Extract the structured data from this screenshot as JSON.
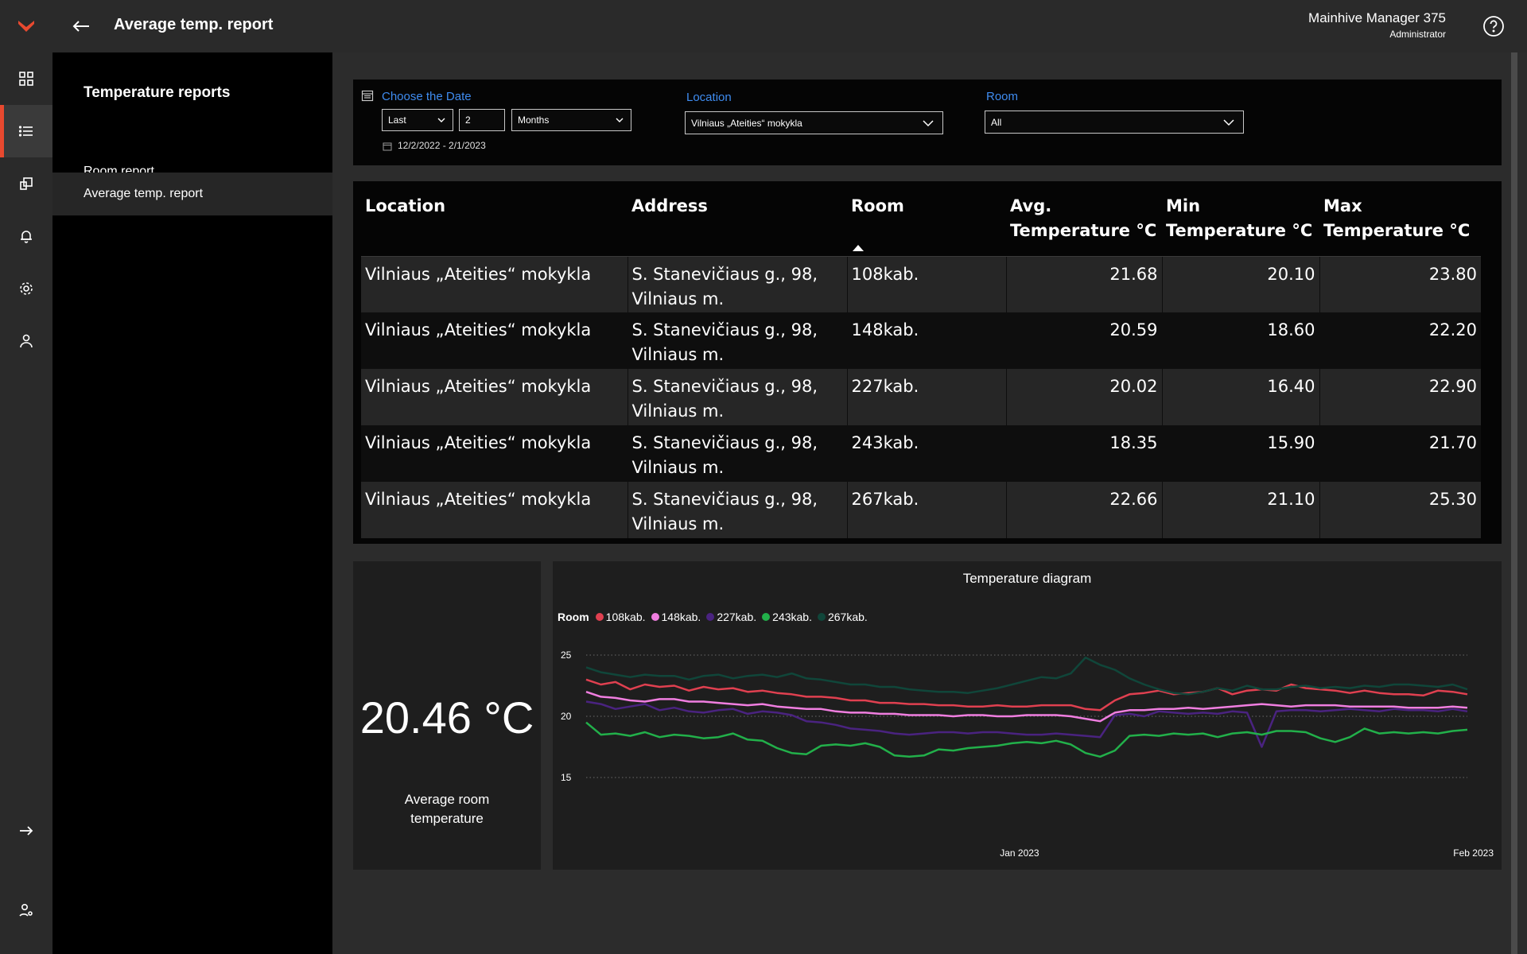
{
  "app": {
    "page_title": "Average temp. report",
    "user_name": "Mainhive Manager 375",
    "user_role": "Administrator",
    "accent": "#e8492f"
  },
  "rail": {
    "icons": [
      "logo-icon",
      "dashboard-icon",
      "reports-list-icon",
      "devices-icon",
      "bell-icon",
      "gear-icon",
      "user-icon",
      "expand-arrow-icon",
      "user-settings-icon"
    ],
    "active": "reports-list-icon"
  },
  "subnav": {
    "title": "Temperature reports",
    "items": [
      {
        "label": "Room report"
      },
      {
        "label": "Average temp. report"
      }
    ]
  },
  "filters": {
    "date_label": "Choose the Date",
    "period_mode": "Last",
    "period_count": "2",
    "period_unit": "Months",
    "date_range": "12/2/2022 - 2/1/2023",
    "location_label": "Location",
    "location_value": "Vilniaus „Ateities“ mokykla",
    "room_label": "Room",
    "room_value": "All"
  },
  "table": {
    "headers": [
      "Location",
      "Address",
      "Room",
      "Avg. Temperature °C",
      "Min Temperature °C",
      "Max Temperature °C"
    ],
    "rows": [
      {
        "location": "Vilniaus „Ateities“ mokykla",
        "address": "S. Stanevičiaus g., 98, Vilniaus m.",
        "room": "108kab.",
        "avg": "21.68",
        "min": "20.10",
        "max": "23.80"
      },
      {
        "location": "Vilniaus „Ateities“ mokykla",
        "address": "S. Stanevičiaus g., 98, Vilniaus m.",
        "room": "148kab.",
        "avg": "20.59",
        "min": "18.60",
        "max": "22.20"
      },
      {
        "location": "Vilniaus „Ateities“ mokykla",
        "address": "S. Stanevičiaus g., 98, Vilniaus m.",
        "room": "227kab.",
        "avg": "20.02",
        "min": "16.40",
        "max": "22.90"
      },
      {
        "location": "Vilniaus „Ateities“ mokykla",
        "address": "S. Stanevičiaus g., 98, Vilniaus m.",
        "room": "243kab.",
        "avg": "18.35",
        "min": "15.90",
        "max": "21.70"
      },
      {
        "location": "Vilniaus „Ateities“ mokykla",
        "address": "S. Stanevičiaus g., 98, Vilniaus m.",
        "room": "267kab.",
        "avg": "22.66",
        "min": "21.10",
        "max": "25.30"
      }
    ]
  },
  "kpi": {
    "value": "20.46 °C",
    "label": "Average room temperature"
  },
  "chart_data": {
    "type": "line",
    "title": "Temperature diagram",
    "legend_title": "Room",
    "legend_position": "top-left",
    "x_ticks": [
      "Jan 2023",
      "Feb 2023"
    ],
    "x_range": [
      "2022-12-02",
      "2023-02-01"
    ],
    "ylim": [
      15,
      25
    ],
    "y_ticks": [
      15,
      20,
      25
    ],
    "grid": "horizontal dotted",
    "series": [
      {
        "name": "108kab.",
        "color": "#e04050",
        "values": [
          23.0,
          22.6,
          22.8,
          22.2,
          22.6,
          22.4,
          22.5,
          22.1,
          22.4,
          22.2,
          22.3,
          22.0,
          22.1,
          21.9,
          21.8,
          21.6,
          21.6,
          21.5,
          21.3,
          21.3,
          21.1,
          21.1,
          21.0,
          21.0,
          20.9,
          20.9,
          20.8,
          20.8,
          20.9,
          20.8,
          20.8,
          20.9,
          20.9,
          20.9,
          20.6,
          20.5,
          21.3,
          21.8,
          21.9,
          22.1,
          21.8,
          21.9,
          22.0,
          22.3,
          21.8,
          22.1,
          22.2,
          22.1,
          22.6,
          22.3,
          22.2,
          22.1,
          21.9,
          22.1,
          21.9,
          21.8,
          21.8,
          21.7,
          22.1,
          22.0,
          21.8
        ]
      },
      {
        "name": "148kab.",
        "color": "#f07ee0",
        "values": [
          22.0,
          21.6,
          21.5,
          21.3,
          21.2,
          21.4,
          21.4,
          21.2,
          21.2,
          21.1,
          21.0,
          20.9,
          21.0,
          20.8,
          20.7,
          20.6,
          20.6,
          20.4,
          20.3,
          20.3,
          20.2,
          20.2,
          20.1,
          20.1,
          20.1,
          20.0,
          20.1,
          20.1,
          20.0,
          20.0,
          20.1,
          20.1,
          20.1,
          20.0,
          19.8,
          19.6,
          20.3,
          20.5,
          20.5,
          20.6,
          20.6,
          20.7,
          20.6,
          20.7,
          20.8,
          20.9,
          21.0,
          20.9,
          20.8,
          20.9,
          20.9,
          20.9,
          20.8,
          20.8,
          20.8,
          20.8,
          20.7,
          20.7,
          20.7,
          20.8,
          20.7
        ]
      },
      {
        "name": "227kab.",
        "color": "#4a2380",
        "values": [
          21.2,
          21.0,
          20.6,
          20.8,
          21.0,
          20.5,
          20.7,
          20.4,
          20.3,
          20.5,
          20.6,
          20.2,
          20.4,
          20.3,
          20.1,
          19.6,
          19.5,
          19.3,
          19.0,
          18.9,
          18.8,
          18.6,
          18.5,
          18.6,
          18.7,
          18.7,
          18.6,
          18.7,
          18.7,
          18.6,
          18.5,
          18.5,
          18.6,
          18.5,
          18.4,
          18.3,
          20.1,
          20.2,
          20.0,
          20.4,
          20.3,
          20.2,
          20.3,
          20.2,
          20.4,
          20.3,
          17.5,
          20.4,
          20.5,
          20.5,
          20.4,
          20.5,
          20.6,
          20.5,
          20.4,
          20.6,
          20.5,
          20.5,
          20.4,
          20.6,
          20.4
        ]
      },
      {
        "name": "243kab.",
        "color": "#22b04a",
        "values": [
          19.5,
          18.5,
          18.6,
          18.4,
          18.7,
          18.3,
          18.5,
          18.4,
          18.2,
          18.3,
          18.6,
          18.1,
          18.0,
          17.4,
          17.0,
          16.9,
          17.6,
          17.7,
          17.6,
          17.8,
          17.5,
          16.8,
          16.7,
          16.8,
          17.3,
          17.2,
          17.4,
          17.5,
          17.6,
          17.8,
          17.9,
          17.8,
          18.0,
          17.7,
          17.0,
          16.7,
          17.2,
          18.4,
          18.5,
          18.4,
          18.6,
          18.5,
          18.6,
          18.3,
          18.6,
          18.7,
          18.5,
          18.8,
          18.8,
          18.7,
          18.2,
          17.9,
          18.3,
          19.0,
          18.6,
          18.7,
          18.6,
          18.7,
          18.6,
          18.8,
          18.9
        ]
      },
      {
        "name": "267kab.",
        "color": "#10463a",
        "values": [
          24.0,
          23.6,
          23.4,
          23.2,
          23.4,
          23.3,
          23.3,
          23.0,
          23.3,
          23.4,
          23.1,
          23.3,
          23.4,
          23.2,
          23.5,
          23.1,
          23.0,
          22.8,
          22.6,
          22.6,
          22.4,
          22.4,
          22.2,
          22.1,
          22.0,
          22.0,
          21.9,
          22.1,
          22.3,
          22.6,
          22.9,
          23.2,
          23.1,
          23.5,
          24.8,
          24.2,
          23.8,
          23.1,
          22.6,
          22.2,
          21.9,
          21.8,
          22.0,
          22.3,
          22.1,
          22.5,
          22.2,
          22.2,
          22.4,
          22.5,
          22.3,
          22.4,
          22.3,
          22.5,
          22.4,
          22.6,
          22.6,
          22.5,
          22.4,
          22.6,
          22.2
        ]
      }
    ]
  }
}
